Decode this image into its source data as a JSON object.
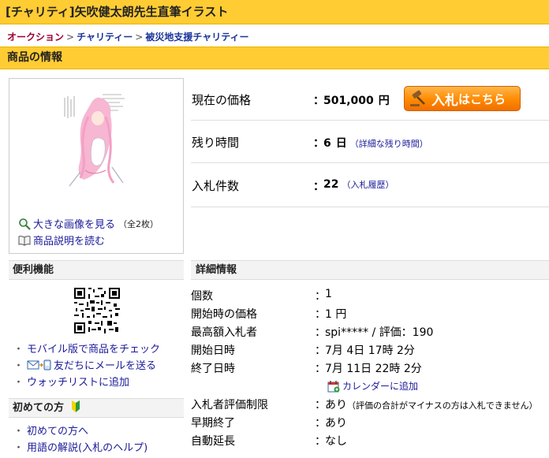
{
  "page": {
    "title": "[チャリティ]矢吹健太朗先生直筆イラスト",
    "breadcrumb": [
      "オークション",
      "チャリティー",
      "被災地支援チャリティー"
    ],
    "breadcrumb_sep": ">",
    "section_title": "商品の情報"
  },
  "image_box": {
    "links": [
      {
        "label": "大きな画像を見る",
        "note": "（全2枚）",
        "icon": "magnifier-icon"
      },
      {
        "label": "商品説明を読む",
        "note": "",
        "icon": "book-icon"
      }
    ]
  },
  "price": {
    "rows": [
      {
        "label": "現在の価格",
        "colon": "：",
        "value": "501,000",
        "unit": "円",
        "link": ""
      },
      {
        "label": "残り時間",
        "colon": "：",
        "value": "6",
        "unit": "日",
        "link": "（詳細な残り時間）"
      },
      {
        "label": "入札件数",
        "colon": "：",
        "value": "22",
        "unit": "",
        "link": "（入札履歴）"
      }
    ],
    "bid_button": {
      "main": "入札",
      "small": "はこちら",
      "icon": "gavel-icon"
    }
  },
  "sidebar": {
    "convenience_title": "便利機能",
    "links": [
      {
        "label": "モバイル版で商品をチェック",
        "icon": ""
      },
      {
        "label": "友だちにメールを送る",
        "icon": "mail-phone-icon"
      },
      {
        "label": "ウォッチリストに追加",
        "icon": ""
      }
    ],
    "beginner_title": "初めての方",
    "beginner_links": [
      {
        "label": "初めての方へ"
      },
      {
        "label": "用語の解説(入札のヘルプ)"
      }
    ]
  },
  "details": {
    "title": "詳細情報",
    "rows": [
      {
        "label": "個数",
        "colon": "：",
        "value": "1"
      },
      {
        "label": "開始時の価格",
        "colon": "：",
        "value": "1 円"
      },
      {
        "label": "最高額入札者",
        "colon": "：",
        "value": "spi***** / 評価：190"
      },
      {
        "label": "開始日時",
        "colon": "：",
        "value": "7月 4日 17時 2分"
      },
      {
        "label": "終了日時",
        "colon": "：",
        "value": "7月 11日 22時 2分"
      }
    ],
    "calendar_link": "カレンダーに追加",
    "rows2": [
      {
        "label": "入札者評価制限",
        "colon": "：",
        "value": "あり",
        "note": "（評価の合計がマイナスの方は入札できません）"
      },
      {
        "label": "早期終了",
        "colon": "：",
        "value": "あり",
        "note": ""
      },
      {
        "label": "自動延長",
        "colon": "：",
        "value": "なし",
        "note": ""
      }
    ]
  },
  "colors": {
    "header_bg": "#ffcc33",
    "link": "#1a1a99",
    "bid_button": "#ff8a00"
  }
}
